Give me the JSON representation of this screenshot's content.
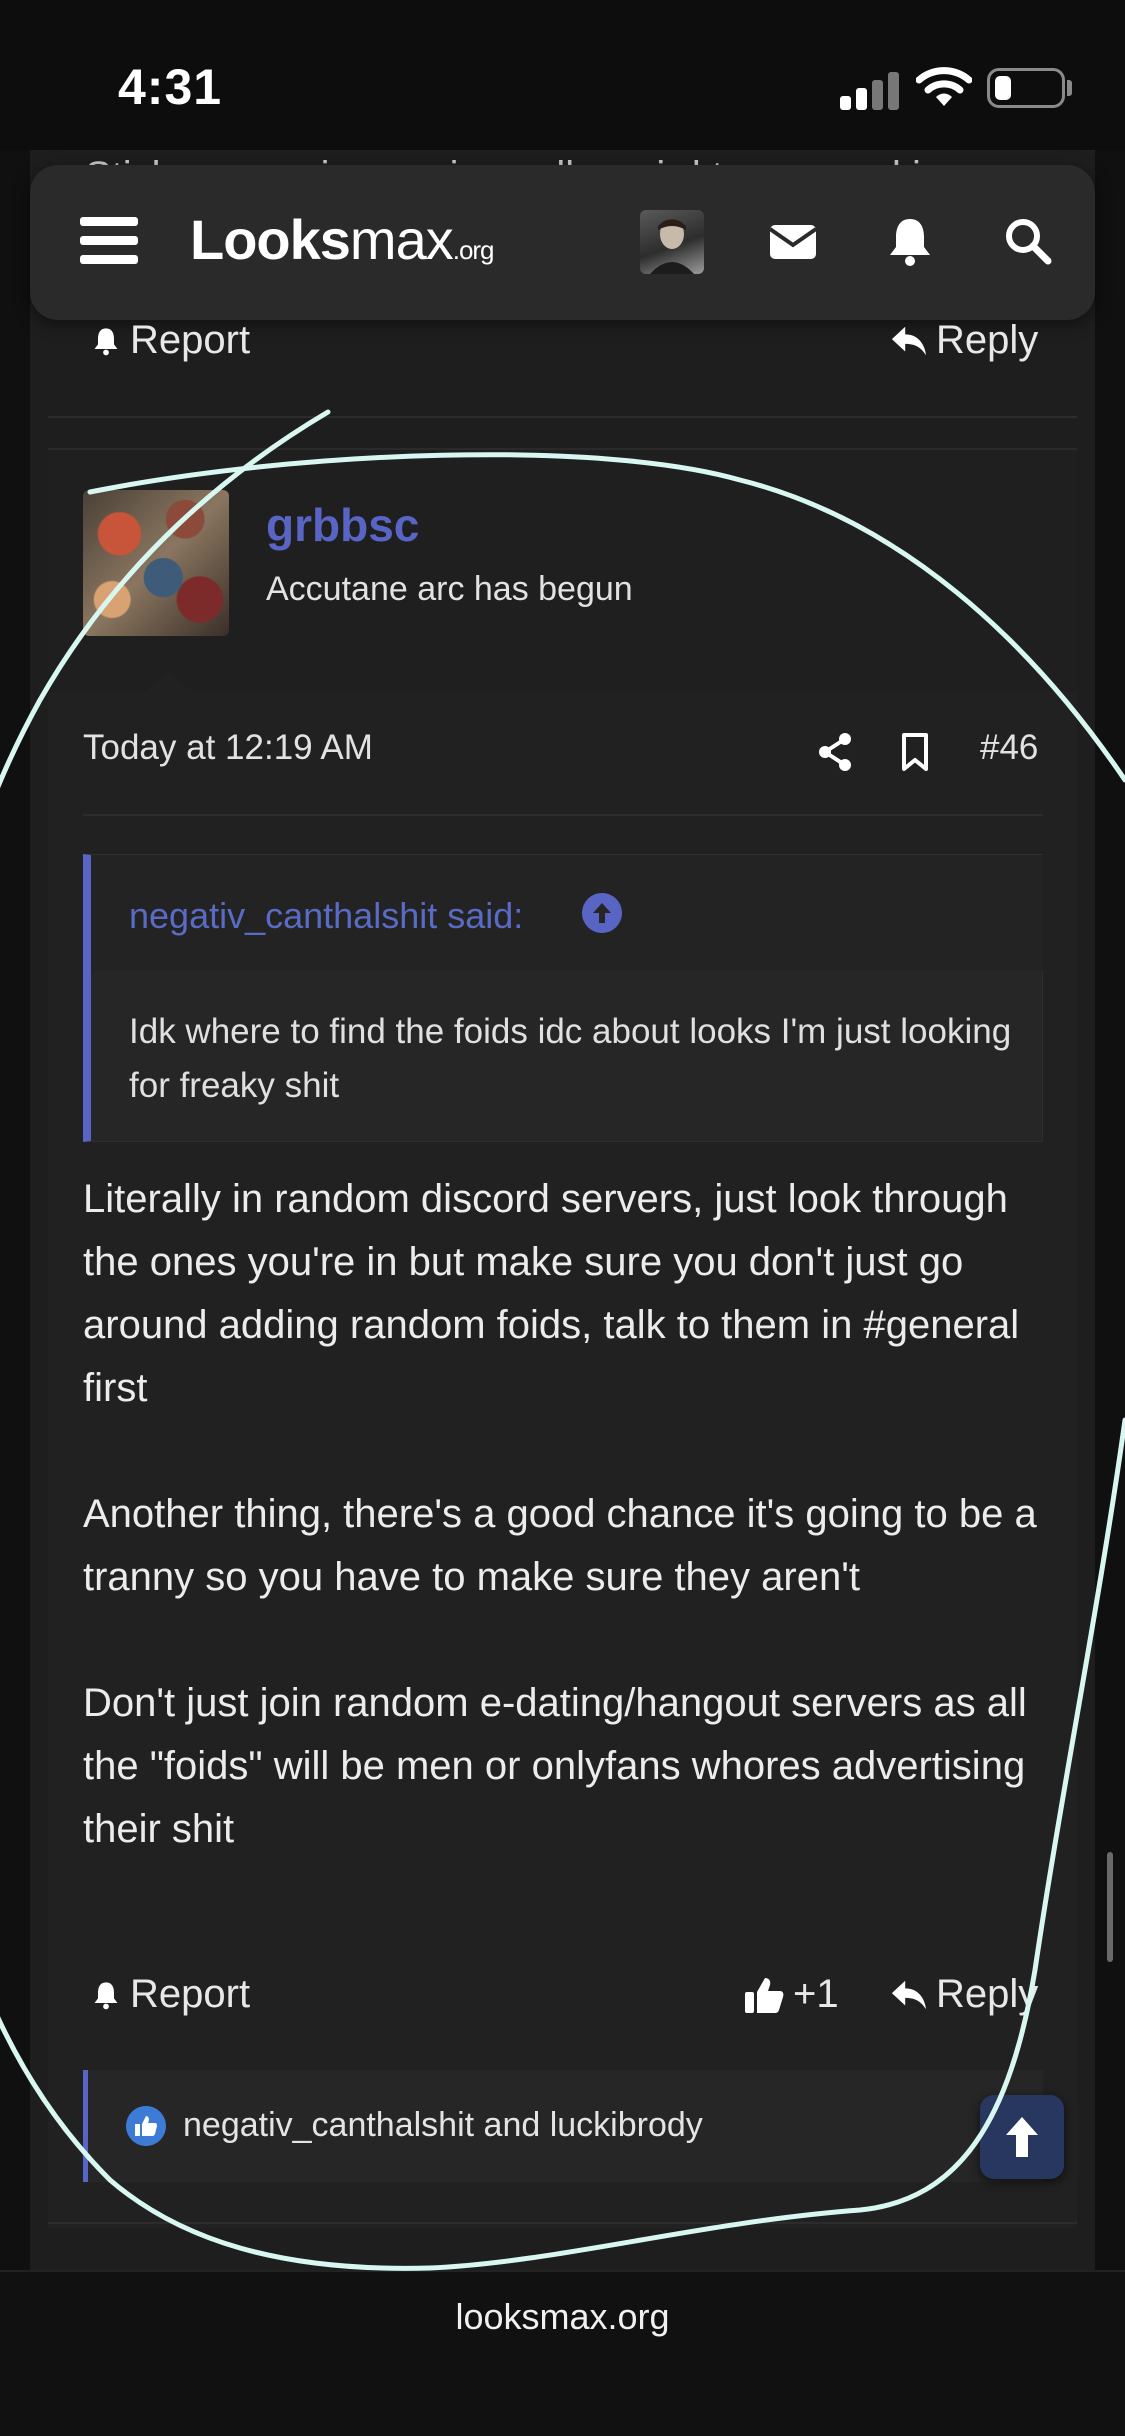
{
  "status_bar": {
    "time": "4:31",
    "battery_level": 0.25
  },
  "prev_peek_text": "Sticky seas piece universally weird tresspoard is",
  "nav": {
    "logo_main": "Looks",
    "logo_max": "max",
    "logo_tld": ".org",
    "icons": [
      "menu-icon",
      "avatar",
      "mail-icon",
      "bell-icon",
      "search-icon"
    ]
  },
  "prev_post": {
    "report_label": "Report",
    "reply_label": "Reply"
  },
  "post": {
    "username": "grbbsc",
    "user_title": "Accutane arc has begun",
    "timestamp": "Today at 12:19 AM",
    "number": "#46",
    "quote": {
      "author": "negativ_canthalshit said:",
      "text": "Idk where to find the foids idc about looks I'm just looking for freaky shit"
    },
    "paragraphs": [
      "Literally in random discord servers, just look through the ones you're in but make sure you don't just go around adding random foids, talk to them in #general first",
      "Another thing, there's a good chance it's going to be a tranny so you have to make sure they aren't",
      "Don't just join random e-dating/hangout servers as all the \"foids\" will be men or onlyfans whores advertising their shit"
    ],
    "actions": {
      "report_label": "Report",
      "like_count": "+1",
      "reply_label": "Reply"
    },
    "reactions_text": "negativ_canthalshit and luckibrody"
  },
  "bottom": {
    "url": "looksmax.org"
  },
  "colors": {
    "accent": "#5865c4",
    "background": "#1e1e1e",
    "annotation_ink": "#d8f7f0"
  }
}
